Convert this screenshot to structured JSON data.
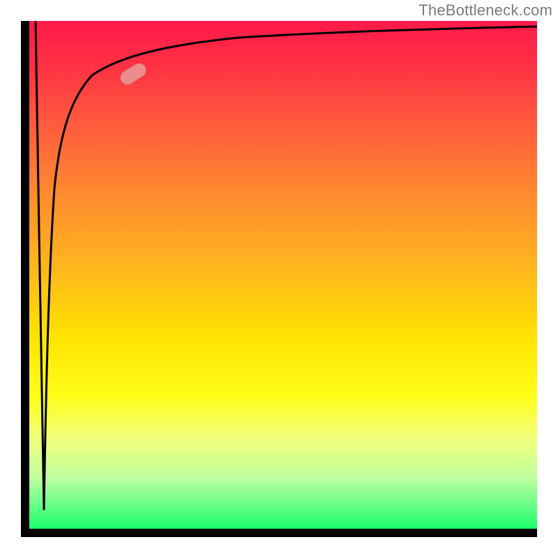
{
  "attribution": "TheBottleneck.com",
  "colors": {
    "frame": "#000000",
    "gradient_top": "#ff1a4a",
    "gradient_bottom": "#1aff6e",
    "curve": "#000000",
    "marker": "#e6a09b"
  },
  "marker": {
    "x_frac": 0.205,
    "y_frac": 0.105,
    "rotation_deg": -32
  },
  "chart_data": {
    "type": "line",
    "title": "",
    "xlabel": "",
    "ylabel": "",
    "xlim": [
      0,
      1
    ],
    "ylim": [
      0,
      1
    ],
    "grid": false,
    "legend": false,
    "annotations": [
      "marker on curve near upper-left knee"
    ],
    "series": [
      {
        "name": "descending-spike",
        "x": [
          0.012,
          0.02,
          0.028
        ],
        "y": [
          1.0,
          0.5,
          0.04
        ]
      },
      {
        "name": "rising-saturating-curve",
        "x": [
          0.028,
          0.035,
          0.045,
          0.06,
          0.08,
          0.11,
          0.15,
          0.205,
          0.28,
          0.38,
          0.5,
          0.65,
          0.82,
          1.0
        ],
        "y": [
          0.04,
          0.3,
          0.52,
          0.68,
          0.78,
          0.84,
          0.88,
          0.905,
          0.925,
          0.942,
          0.955,
          0.965,
          0.972,
          0.978
        ]
      }
    ],
    "highlight_point": {
      "x": 0.205,
      "y": 0.895
    }
  }
}
